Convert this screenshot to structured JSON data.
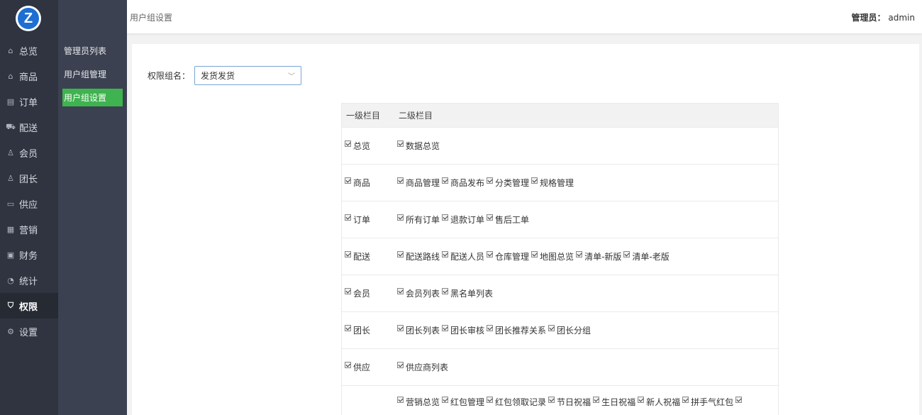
{
  "logo_letter": "Z",
  "nav": [
    {
      "label": "总览",
      "icon": "home-icon",
      "glyph": "⌂"
    },
    {
      "label": "商品",
      "icon": "goods-icon",
      "glyph": "⌂"
    },
    {
      "label": "订单",
      "icon": "order-icon",
      "glyph": "▤"
    },
    {
      "label": "配送",
      "icon": "delivery-icon",
      "glyph": "⛟"
    },
    {
      "label": "会员",
      "icon": "member-icon",
      "glyph": "♙"
    },
    {
      "label": "团长",
      "icon": "leader-icon",
      "glyph": "♙"
    },
    {
      "label": "供应",
      "icon": "supply-icon",
      "glyph": "▭"
    },
    {
      "label": "营销",
      "icon": "gift-icon",
      "glyph": "▦"
    },
    {
      "label": "财务",
      "icon": "finance-icon",
      "glyph": "▣"
    },
    {
      "label": "统计",
      "icon": "chart-icon",
      "glyph": "◔"
    },
    {
      "label": "权限",
      "icon": "shield-icon",
      "glyph": "⛉",
      "active": true
    },
    {
      "label": "设置",
      "icon": "gear-icon",
      "glyph": "⚙"
    }
  ],
  "subnav": [
    {
      "label": "管理员列表"
    },
    {
      "label": "用户组管理"
    },
    {
      "label": "用户组设置",
      "active": true
    }
  ],
  "header": {
    "breadcrumb": "用户组设置",
    "admin_label": "管理员：",
    "admin_name": "admin"
  },
  "form": {
    "label": "权限组名：",
    "selected_value": "发货发货"
  },
  "table": {
    "col1": "一级栏目",
    "col2": "二级栏目",
    "rows": [
      {
        "first": "总览",
        "second": [
          "数据总览"
        ]
      },
      {
        "first": "商品",
        "second": [
          "商品管理",
          "商品发布",
          "分类管理",
          "规格管理"
        ]
      },
      {
        "first": "订单",
        "second": [
          "所有订单",
          "退款订单",
          "售后工单"
        ]
      },
      {
        "first": "配送",
        "second": [
          "配送路线",
          "配送人员",
          "仓库管理",
          "地图总览",
          "清单-新版",
          "清单-老版"
        ]
      },
      {
        "first": "会员",
        "second": [
          "会员列表",
          "黑名单列表"
        ]
      },
      {
        "first": "团长",
        "second": [
          "团长列表",
          "团长审核",
          "团长推荐关系",
          "团长分组"
        ]
      },
      {
        "first": "供应",
        "second": [
          "供应商列表"
        ]
      },
      {
        "first": "",
        "second": [
          "营销总览",
          "红包管理",
          "红包领取记录",
          "节日祝福",
          "生日祝福",
          "新人祝福",
          "拼手气红包",
          ""
        ]
      }
    ]
  }
}
